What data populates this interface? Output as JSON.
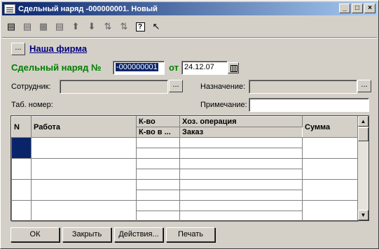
{
  "window": {
    "title": "Сдельный наряд -000000001. Новый",
    "min_label": "_",
    "max_label": "□",
    "close_label": "×"
  },
  "toolbar": {
    "icons": [
      "new-row-icon",
      "copy-row-icon",
      "delete-row-icon",
      "edit-row-icon",
      "move-up-icon",
      "move-down-icon",
      "sort-asc-icon",
      "sort-desc-icon",
      "help-icon",
      "whats-this-icon"
    ],
    "help_label": "?"
  },
  "firm": {
    "button_label": "...",
    "link_label": "Наша фирма"
  },
  "document": {
    "label": "Сдельный наряд №",
    "number": "-000000001",
    "date_label": "от",
    "date": "24.12.07"
  },
  "fields": {
    "employee_label": "Сотрудник:",
    "employee_value": "",
    "purpose_label": "Назначение:",
    "purpose_value": "",
    "tab_number_label": "Таб. номер:",
    "note_label": "Примечание:",
    "note_value": ""
  },
  "grid": {
    "columns_top": [
      "N",
      "Работа",
      "К-во",
      "Хоз. операция",
      "Сумма"
    ],
    "columns_sub": [
      "К-во в ...",
      "Заказ"
    ],
    "rows": 4
  },
  "buttons": {
    "ok": "ОК",
    "close": "Закрыть",
    "actions": "Действия...",
    "print": "Печать"
  }
}
